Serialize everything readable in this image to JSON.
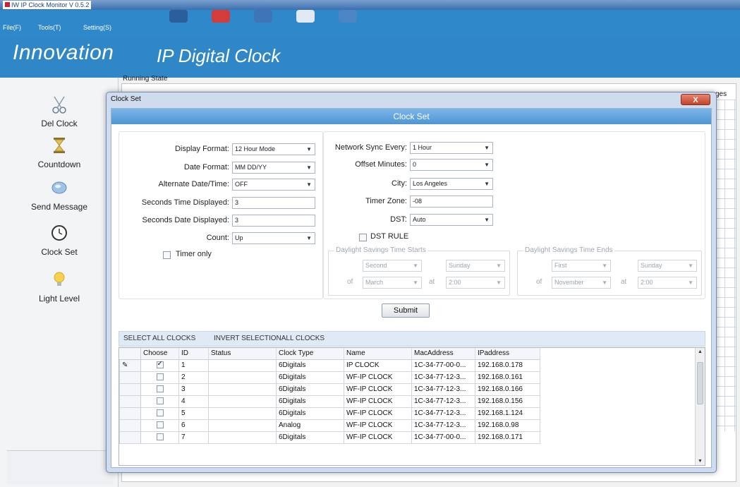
{
  "window": {
    "title": "IW IP Clock Monitor V 0.5.2"
  },
  "menu": [
    "File(F)",
    "Tools(T)",
    "Setting(S)"
  ],
  "banner": {
    "logo": "Innovation",
    "title": "IP Digital Clock"
  },
  "sidebar": {
    "items": [
      {
        "label": "Del Clock",
        "icon": "scissors-icon"
      },
      {
        "label": "Countdown",
        "icon": "hourglass-icon"
      },
      {
        "label": "Send Message",
        "icon": "message-icon"
      },
      {
        "label": "Clock Set",
        "icon": "clock-icon"
      },
      {
        "label": "Light Level",
        "icon": "bulb-icon"
      }
    ]
  },
  "running": {
    "label": "Running State",
    "messages_tab": "ges"
  },
  "dialog": {
    "title": "Clock Set",
    "header": "Clock Set",
    "close": "X",
    "left_form": {
      "display_format": {
        "label": "Display Format:",
        "value": "12 Hour Mode"
      },
      "date_format": {
        "label": "Date Format:",
        "value": "MM DD/YY"
      },
      "alternate": {
        "label": "Alternate Date/Time:",
        "value": "OFF"
      },
      "seconds_time": {
        "label": "Seconds Time Displayed:",
        "value": "3"
      },
      "seconds_date": {
        "label": "Seconds Date Displayed:",
        "value": "3"
      },
      "count": {
        "label": "Count:",
        "value": "Up"
      },
      "timer_only": {
        "label": "Timer only"
      }
    },
    "right_form": {
      "sync": {
        "label": "Network Sync Every:",
        "value": "1 Hour"
      },
      "offset": {
        "label": "Offset Minutes:",
        "value": "0"
      },
      "city": {
        "label": "City:",
        "value": "Los Angeles"
      },
      "timezone": {
        "label": "Timer Zone:",
        "value": "-08"
      },
      "dst": {
        "label": "DST:",
        "value": "Auto"
      },
      "dst_rule": {
        "label": "DST RULE"
      }
    },
    "dst_start": {
      "legend": "Daylight Savings Time Starts",
      "week": "Second",
      "day": "Sunday",
      "of": "of",
      "month": "March",
      "at": "at",
      "time": "2:00"
    },
    "dst_end": {
      "legend": "Daylight Savings Time Ends",
      "week": "First",
      "day": "Sunday",
      "of": "of",
      "month": "November",
      "at": "at",
      "time": "2:00"
    },
    "submit": "Submit",
    "select_all": "SELECT ALL CLOCKS",
    "invert": "INVERT SELECTIONALL CLOCKS",
    "table": {
      "columns": [
        "Choose",
        "ID",
        "Status",
        "Clock Type",
        "Name",
        "MacAddress",
        "IPaddress"
      ],
      "rows": [
        {
          "checked": true,
          "id": "1",
          "status": "",
          "type": "6Digitals",
          "name": "IP CLOCK",
          "mac": "1C-34-77-00-0...",
          "ip": "192.168.0.178"
        },
        {
          "checked": false,
          "id": "2",
          "status": "",
          "type": "6Digitals",
          "name": "WF-IP CLOCK",
          "mac": "1C-34-77-12-3...",
          "ip": "192.168.0.161"
        },
        {
          "checked": false,
          "id": "3",
          "status": "",
          "type": "6Digitals",
          "name": "WF-IP CLOCK",
          "mac": "1C-34-77-12-3...",
          "ip": "192.168.0.166"
        },
        {
          "checked": false,
          "id": "4",
          "status": "",
          "type": "6Digitals",
          "name": "WF-IP CLOCK",
          "mac": "1C-34-77-12-3...",
          "ip": "192.168.0.156"
        },
        {
          "checked": false,
          "id": "5",
          "status": "",
          "type": "6Digitals",
          "name": "WF-IP CLOCK",
          "mac": "1C-34-77-12-3...",
          "ip": "192.168.1.124"
        },
        {
          "checked": false,
          "id": "6",
          "status": "",
          "type": "Analog",
          "name": "WF-IP CLOCK",
          "mac": "1C-34-77-12-3...",
          "ip": "192.168.0.98"
        },
        {
          "checked": false,
          "id": "7",
          "status": "",
          "type": "6Digitals",
          "name": "WF-IP CLOCK",
          "mac": "1C-34-77-00-0...",
          "ip": "192.168.0.171"
        }
      ]
    }
  }
}
